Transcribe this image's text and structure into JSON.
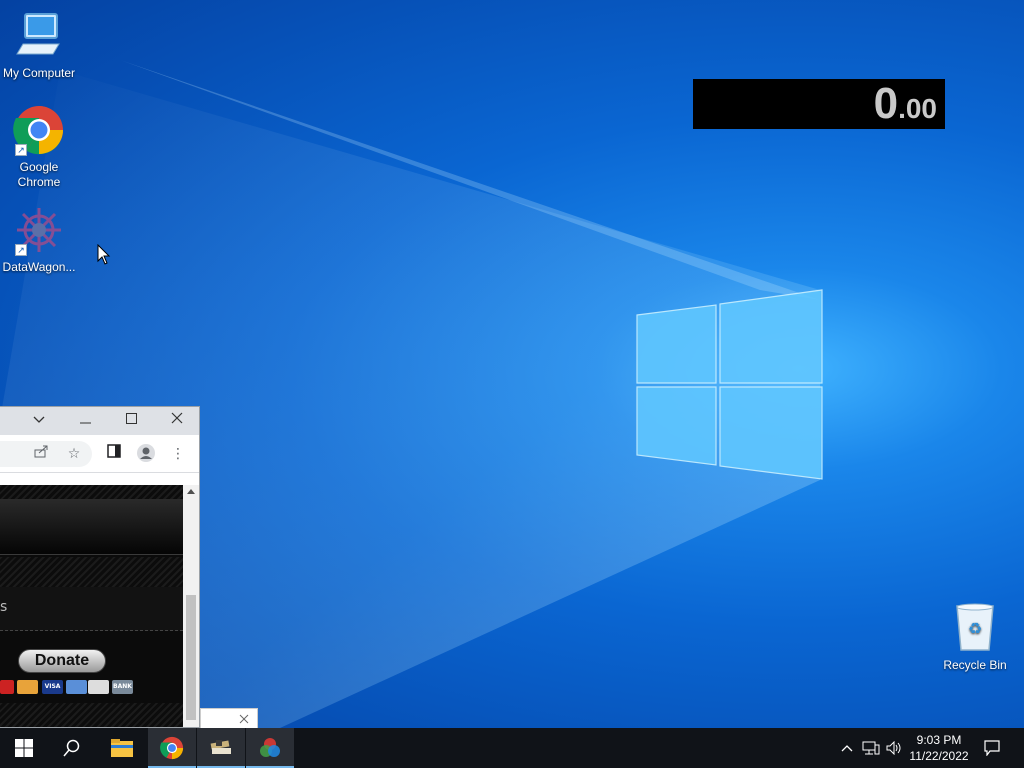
{
  "desktop": {
    "icons": [
      {
        "label": "My Computer"
      },
      {
        "label": "Google Chrome"
      },
      {
        "label": "DataWagon..."
      },
      {
        "label": "Recycle Bin"
      }
    ]
  },
  "timer": {
    "whole": "0",
    "fraction": ".00"
  },
  "browser": {
    "partial_text": "s",
    "donate_label": "Donate",
    "cards": [
      "VISA",
      "BANK"
    ]
  },
  "taskbar": {
    "time": "9:03 PM",
    "date": "11/22/2022"
  },
  "colors": {
    "taskbar_bg": "#101318",
    "accent": "#76b9ed",
    "desktop_blue": "#0a66d2"
  }
}
